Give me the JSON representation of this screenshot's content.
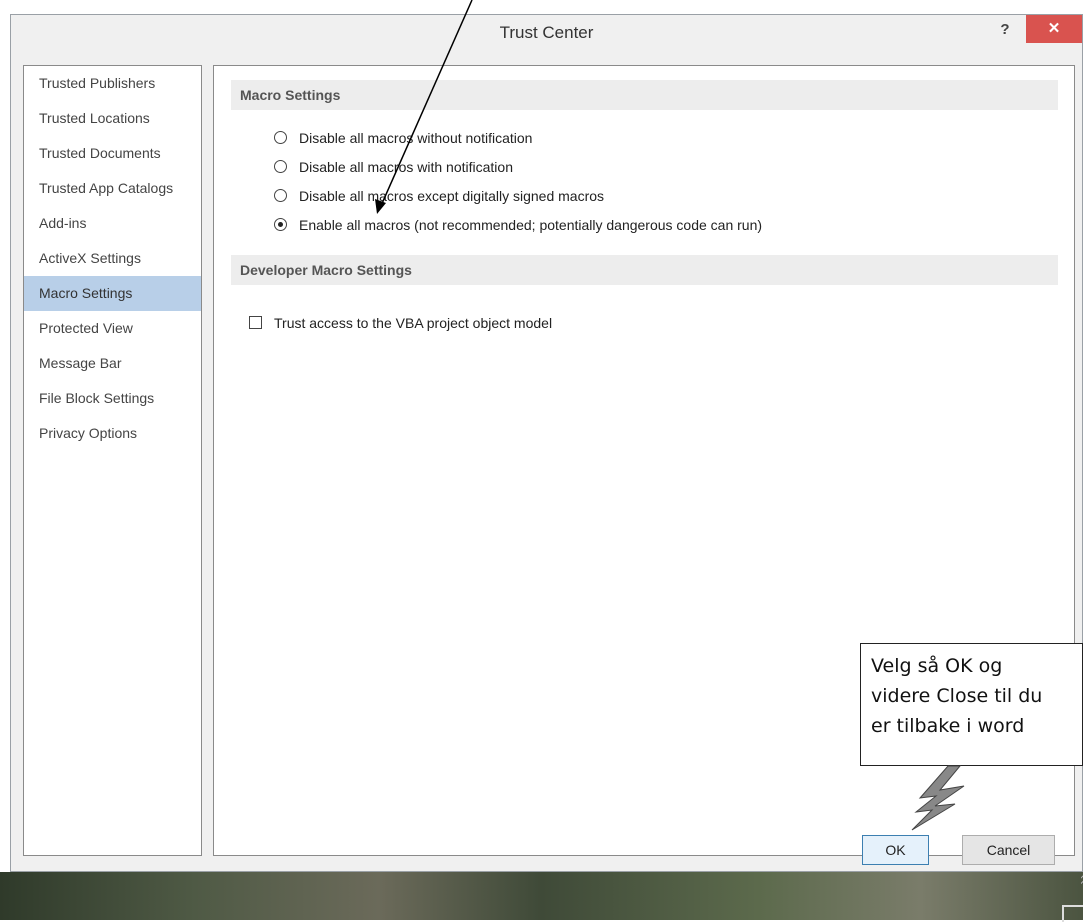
{
  "window": {
    "title": "Trust Center",
    "help_label": "?",
    "close_label": "✕"
  },
  "sidebar": {
    "items": [
      {
        "label": "Trusted Publishers"
      },
      {
        "label": "Trusted Locations"
      },
      {
        "label": "Trusted Documents"
      },
      {
        "label": "Trusted App Catalogs"
      },
      {
        "label": "Add-ins"
      },
      {
        "label": "ActiveX Settings"
      },
      {
        "label": "Macro Settings",
        "selected": true
      },
      {
        "label": "Protected View"
      },
      {
        "label": "Message Bar"
      },
      {
        "label": "File Block Settings"
      },
      {
        "label": "Privacy Options"
      }
    ]
  },
  "macro_settings": {
    "header": "Macro Settings",
    "options": [
      {
        "label": "Disable all macros without notification",
        "checked": false
      },
      {
        "label": "Disable all macros with notification",
        "checked": false
      },
      {
        "label": "Disable all macros except digitally signed macros",
        "checked": false
      },
      {
        "label": "Enable all macros (not recommended; potentially dangerous code can run)",
        "checked": true
      }
    ]
  },
  "developer_settings": {
    "header": "Developer Macro Settings",
    "vba_access_label": "Trust access to the VBA project object model",
    "vba_access_checked": false
  },
  "buttons": {
    "ok": "OK",
    "cancel": "Cancel"
  },
  "annotation": {
    "lines": [
      "Velg så OK og",
      "videre Close til du",
      "er tilbake i word"
    ]
  },
  "colors": {
    "selected_bg": "#b8cfe8",
    "close_bg": "#d9534f",
    "section_bg": "#ededed"
  }
}
